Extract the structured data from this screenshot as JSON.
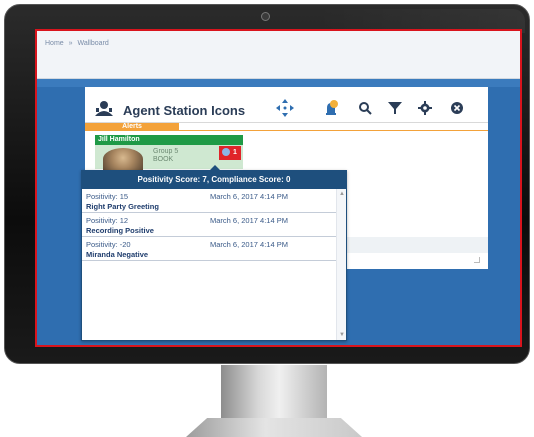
{
  "breadcrumb": [
    "Home",
    "»",
    "Wallboard"
  ],
  "panel": {
    "title": "Agent Station Icons",
    "alerts_tab": "Alerts"
  },
  "agent_card": {
    "name": "Jill Hamilton",
    "group": "Group 5",
    "group_sub": "BOOK",
    "alert_count": "1"
  },
  "popup": {
    "header": "Positivity Score: 7, Compliance Score: 0",
    "rows": [
      {
        "positivity": "Positivity: 15",
        "date": "March 6, 2017 4:14 PM",
        "category": "Right Party Greeting"
      },
      {
        "positivity": "Positivity: 12",
        "date": "March 6, 2017 4:14 PM",
        "category": "Recording Positive"
      },
      {
        "positivity": "Positivity: -20",
        "date": "March 6, 2017 4:14 PM",
        "category": "Miranda Negative"
      }
    ]
  },
  "icons": {
    "agent": "agent-icon",
    "move": "move-arrows-icon",
    "alert": "alert-bell-icon",
    "search": "search-icon",
    "filter": "filter-icon",
    "settings": "gear-icon",
    "close": "close-icon"
  },
  "colors": {
    "screen_bg": "#2f6eb0",
    "alerts_orange": "#f3a23a",
    "agent_green": "#1f9a46",
    "popup_navy": "#1e4f7d",
    "alert_red": "#e0242a",
    "frame_red": "#d9141d"
  }
}
